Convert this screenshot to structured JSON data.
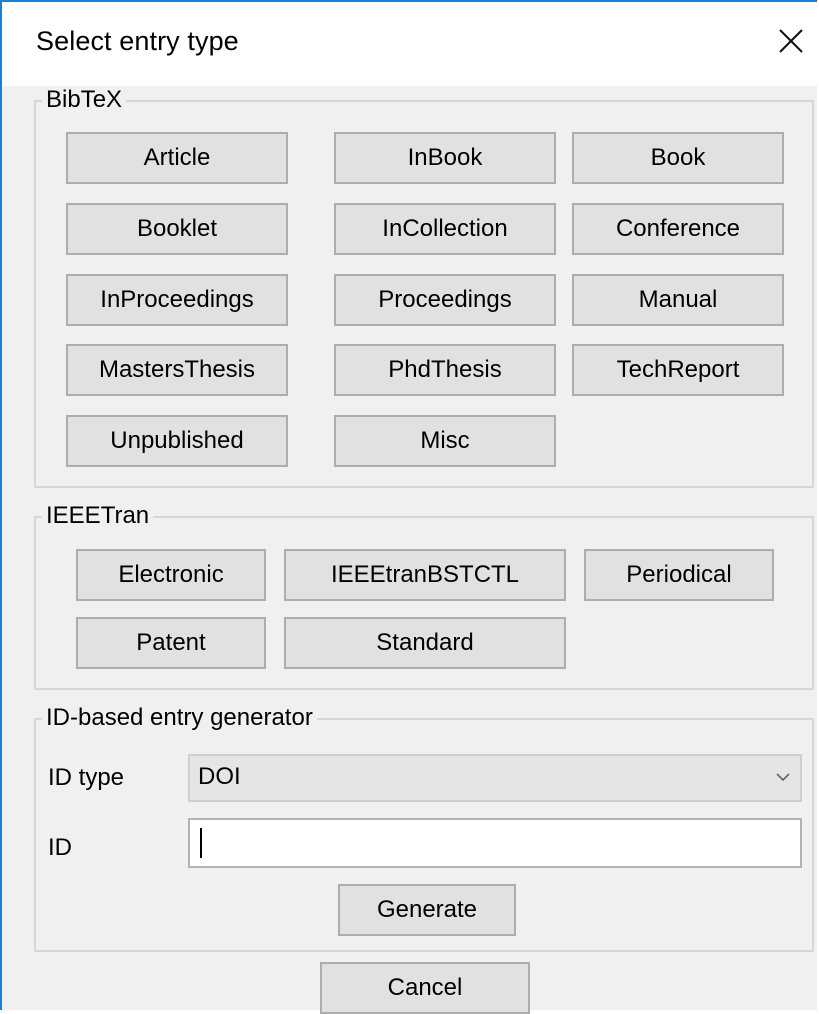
{
  "dialog": {
    "title": "Select entry type",
    "close_icon": "close-icon"
  },
  "bibtex": {
    "legend": "BibTeX",
    "buttons": [
      "Article",
      "InBook",
      "Book",
      "Booklet",
      "InCollection",
      "Conference",
      "InProceedings",
      "Proceedings",
      "Manual",
      "MastersThesis",
      "PhdThesis",
      "TechReport",
      "Unpublished",
      "Misc"
    ]
  },
  "ieeetran": {
    "legend": "IEEETran",
    "buttons": [
      "Electronic",
      "IEEEtranBSTCTL",
      "Periodical",
      "Patent",
      "Standard"
    ]
  },
  "id_generator": {
    "legend": "ID-based entry generator",
    "id_type_label": "ID type",
    "id_type_value": "DOI",
    "id_label": "ID",
    "id_value": "",
    "generate_label": "Generate"
  },
  "footer": {
    "cancel_label": "Cancel"
  },
  "colors": {
    "title_border": "#1a7fd6",
    "button_face": "#e1e1e1",
    "button_border": "#adadad",
    "background": "#f0f0f0"
  }
}
